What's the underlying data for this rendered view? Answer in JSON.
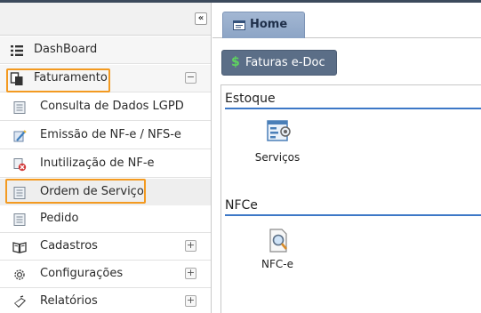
{
  "sidebar": {
    "collapse_symbol": "«",
    "items": [
      {
        "label": "DashBoard",
        "icon": "list-icon"
      },
      {
        "label": "Faturamento",
        "icon": "documents-icon",
        "expander": "−"
      },
      {
        "label": "Consulta de Dados LGPD",
        "icon": "form-icon"
      },
      {
        "label": "Emissão de NF-e / NFS-e",
        "icon": "edit-pen-icon"
      },
      {
        "label": "Inutilização de NF-e",
        "icon": "invalidate-icon"
      },
      {
        "label": "Ordem de Serviço",
        "icon": "form-icon"
      },
      {
        "label": "Pedido",
        "icon": "form-icon"
      },
      {
        "label": "Cadastros",
        "icon": "book-icon",
        "expander": "+"
      },
      {
        "label": "Configurações",
        "icon": "gear-icon",
        "expander": "+"
      },
      {
        "label": "Relatórios",
        "icon": "report-icon",
        "expander": "+"
      }
    ]
  },
  "tabs": [
    {
      "label": "Home",
      "icon": "window-icon"
    }
  ],
  "toolbar": {
    "faturas_symbol": "$",
    "faturas_label": "Faturas e-Doc"
  },
  "sections": [
    {
      "title": "Estoque",
      "tiles": [
        {
          "label": "Serviços",
          "icon": "services-report-icon"
        }
      ]
    },
    {
      "title": "NFCe",
      "tiles": [
        {
          "label": "NFC-e",
          "icon": "magnifier-document-icon"
        }
      ]
    }
  ],
  "colors": {
    "highlight": "#f39a21",
    "section_rule": "#3d78c7",
    "tab": "#8ca4c5",
    "button": "#5b6e87"
  }
}
